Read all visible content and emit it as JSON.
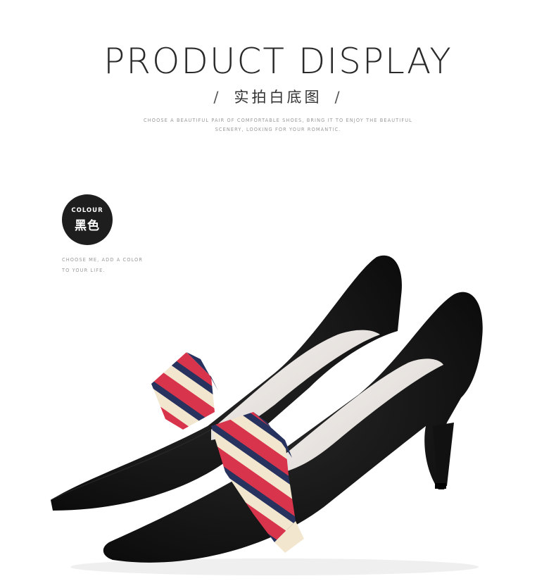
{
  "header": {
    "title": "PRODUCT DISPLAY",
    "subtitle_left_slash": "/",
    "subtitle": "实拍白底图",
    "subtitle_right_slash": "/",
    "tagline_line1": "CHOOSE A BEAUTIFUL PAIR OF COMFORTABLE SHOES, BRING IT TO ENJOY THE BEAUTIFUL",
    "tagline_line2": "SCENERY, LOOKING FOR YOUR ROMANTIC."
  },
  "colour_badge": {
    "label": "COLOUR",
    "value": "黑色"
  },
  "choose_note": {
    "line1": "CHOOSE ME, ADD A COLOR",
    "line2": "TO YOUR LIFE."
  },
  "product_image": {
    "description_icon": "black-pointed-pumps-with-striped-bow"
  },
  "colors": {
    "shoe": "#141414",
    "ribbon_red": "#d8344c",
    "ribbon_navy": "#27325e",
    "ribbon_cream": "#f2e6cf",
    "badge_bg": "#1e1e1e"
  }
}
